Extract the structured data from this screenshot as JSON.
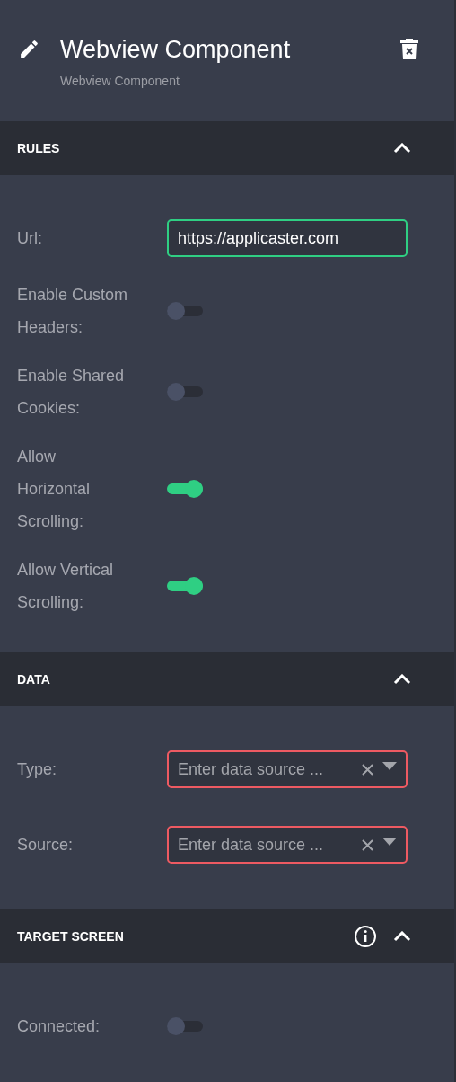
{
  "header": {
    "title": "Webview Component",
    "subtitle": "Webview Component"
  },
  "sections": [
    {
      "title": "RULES",
      "expanded": true,
      "info": false,
      "fields": [
        {
          "kind": "text",
          "label": "Url:",
          "value": "https://applicaster.com",
          "invalid": false
        },
        {
          "kind": "toggle",
          "label": "Enable Custom Headers:",
          "on": false
        },
        {
          "kind": "toggle",
          "label": "Enable Shared Cookies:",
          "on": false
        },
        {
          "kind": "toggle",
          "label": "Allow Horizontal Scrolling:",
          "on": true
        },
        {
          "kind": "toggle",
          "label": "Allow Vertical Scrolling:",
          "on": true
        }
      ]
    },
    {
      "title": "DATA",
      "expanded": true,
      "info": false,
      "fields": [
        {
          "kind": "select",
          "label": "Type:",
          "placeholder": "Enter data source ...",
          "invalid": true
        },
        {
          "kind": "select",
          "label": "Source:",
          "placeholder": "Enter data source ...",
          "invalid": true
        }
      ]
    },
    {
      "title": "TARGET SCREEN",
      "expanded": true,
      "info": true,
      "fields": [
        {
          "kind": "toggle",
          "label": "Connected:",
          "on": false
        }
      ]
    }
  ]
}
